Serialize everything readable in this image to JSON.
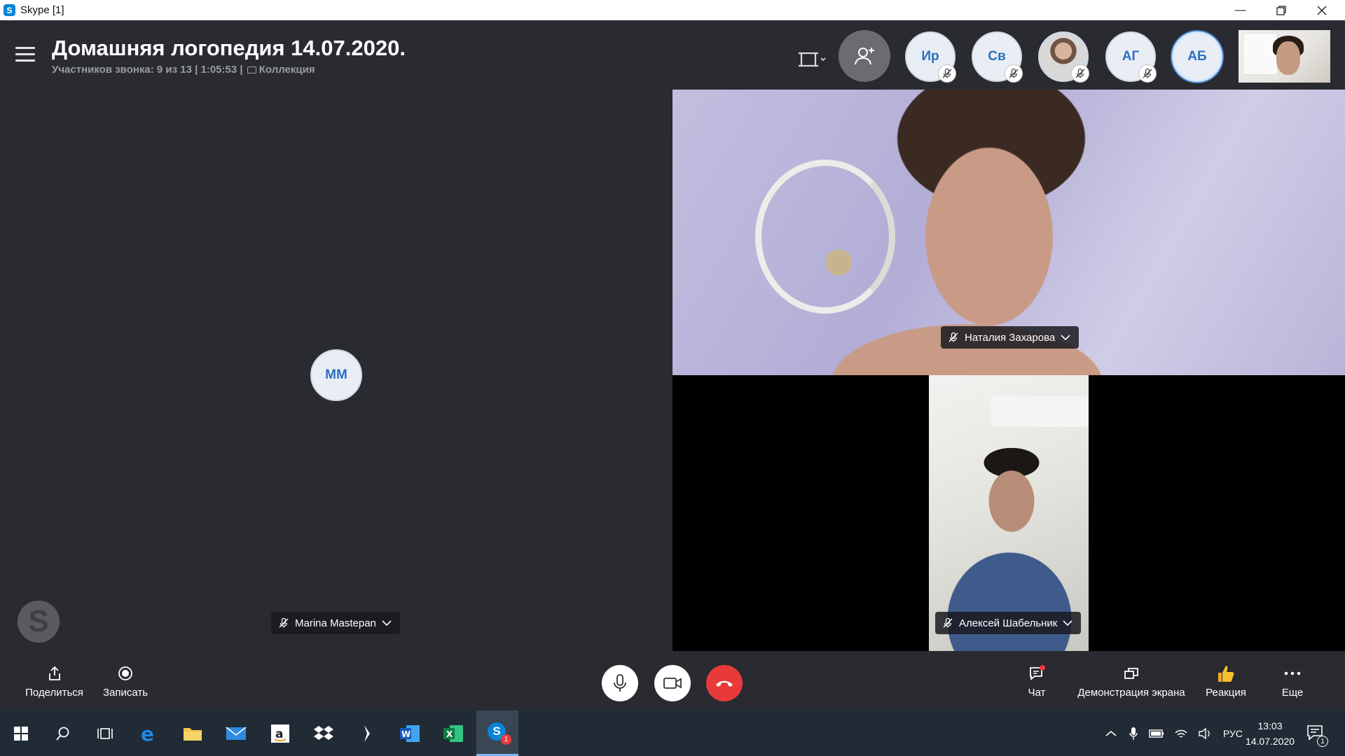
{
  "window": {
    "title": "Skype [1]"
  },
  "call": {
    "title": "Домашняя логопедия 14.07.2020.",
    "subtitle": "Участников звонка: 9 из 13 | 1:05:53 |",
    "collection": "Коллекция"
  },
  "participants": [
    {
      "initials": "Ир",
      "muted": true
    },
    {
      "initials": "Св",
      "muted": true
    },
    {
      "initials": "",
      "muted": true,
      "photo": true
    },
    {
      "initials": "АГ",
      "muted": true
    },
    {
      "initials": "АБ",
      "muted": false,
      "selected": true
    }
  ],
  "stage": {
    "left_initials": "ММ",
    "left_name": "Marina Mastepan",
    "top_name": "Наталия Захарова",
    "bottom_name": "Алексей Шабельник",
    "watermark": "S"
  },
  "controls": {
    "share": "Поделиться",
    "record": "Записать",
    "chat": "Чат",
    "screen_share": "Демонстрация экрана",
    "reaction": "Реакция",
    "more": "Еще"
  },
  "taskbar": {
    "lang": "РУС",
    "time": "13:03",
    "date": "14.07.2020",
    "notif_count": "1",
    "skype_badge": "1"
  },
  "colors": {
    "bg": "#292b31",
    "accent": "#2d6fc0",
    "hangup": "#e83a3a",
    "taskbar": "#202b35"
  }
}
